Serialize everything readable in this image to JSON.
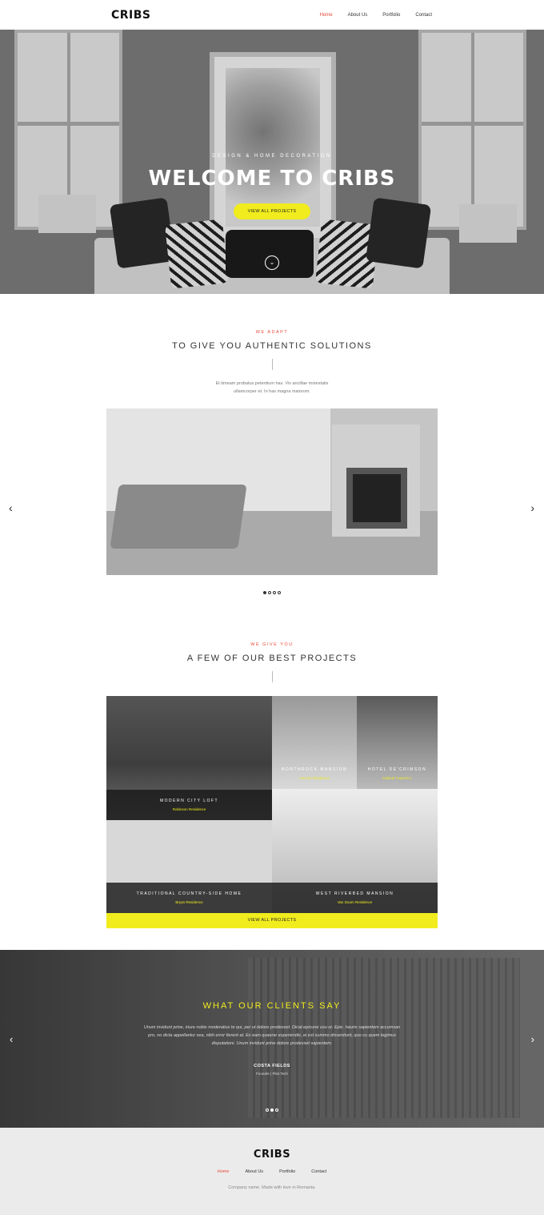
{
  "header": {
    "logo": "CRIBS",
    "nav": [
      {
        "label": "Home",
        "active": true
      },
      {
        "label": "About Us",
        "active": false
      },
      {
        "label": "Portfolio",
        "active": false
      },
      {
        "label": "Contact",
        "active": false
      }
    ]
  },
  "hero": {
    "subtitle": "DESIGN & HOME DECORATION",
    "title": "WELCOME TO CRIBS",
    "button": "VIEW ALL PROJECTS",
    "scroll_icon": "chevron-down-circle-icon"
  },
  "solutions": {
    "eyebrow": "WE ADAPT",
    "title": "TO GIVE YOU AUTHENTIC SOLUTIONS",
    "description_line1": "Et timeam probatus petentium has. Vix ancillae moiestatis",
    "description_line2": "ullamcorper et. In has magna maiorum.",
    "prev_icon": "‹",
    "next_icon": "›",
    "dots": [
      true,
      false,
      false,
      false
    ]
  },
  "projects": {
    "eyebrow": "WE GIVE YOU",
    "title": "A FEW OF OUR BEST PROJECTS",
    "items": [
      {
        "name": "MODERN CITY LOFT",
        "sub": "Robinson Residence"
      },
      {
        "name": "NORTHROCK MANSION",
        "sub": "LaCroix Residence"
      },
      {
        "name": "HOTEL DE'CRIMSON",
        "sub": "Cultural Travel Inc."
      },
      {
        "name": "TRADITIONAL COUNTRY-SIDE HOME",
        "sub": "Bryan Residence"
      },
      {
        "name": "WEST RIVERBED MANSION",
        "sub": "Van Doom Residence"
      }
    ],
    "button": "VIEW ALL PROJECTS"
  },
  "testimonials": {
    "title": "WHAT OUR CLIENTS SAY",
    "quote_line1": "Unum invidunt prine, iriure nobis moderatius te qui, per ut dolore prodesset. Dicat epicurei usu ut. Epic. hauris sapientem accumsan",
    "quote_line2": "pro, no dicta appellantur sea, nibh error fierent at. Ex eam quaerar experiendis, ei est summo dissentiunt, quo cu quem legimus",
    "quote_line3": "disputationi. Unum invidunt prine dolore prodesset sapientem.",
    "name": "COSTA FIELDS",
    "role": "Founder | Pilot Tech",
    "prev_icon": "‹",
    "next_icon": "›",
    "dots": [
      false,
      true,
      false
    ]
  },
  "footer": {
    "logo": "CRIBS",
    "nav": [
      {
        "label": "Home",
        "active": true
      },
      {
        "label": "About Us",
        "active": false
      },
      {
        "label": "Portfolio",
        "active": false
      },
      {
        "label": "Contact",
        "active": false
      }
    ],
    "copyright": "Company name. Made with love in Romania."
  },
  "colors": {
    "accent_red": "#e8493a",
    "accent_yellow": "#f1ec1d"
  }
}
